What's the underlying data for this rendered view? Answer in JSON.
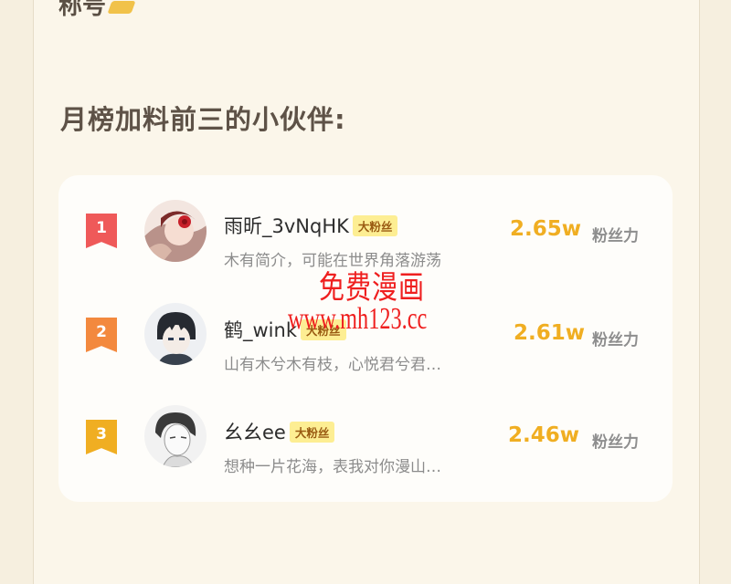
{
  "section": {
    "top_fragment": "称号",
    "heading": "月榜加料前三的小伙伴:"
  },
  "ranking": [
    {
      "rank": "1",
      "name": "雨昕_3vNqHK",
      "badge": "大粉丝",
      "bio": "木有简介，可能在世界角落游荡",
      "score": "2.65w",
      "unit": "粉丝力",
      "avatar_icon": "anime-girl-red-flower-avatar"
    },
    {
      "rank": "2",
      "name": "鹤_wink",
      "badge": "大粉丝",
      "bio": "山有木兮木有枝，心悦君兮君…",
      "score": "2.61w",
      "unit": "粉丝力",
      "avatar_icon": "anime-boy-dark-hair-avatar"
    },
    {
      "rank": "3",
      "name": "幺幺ee",
      "badge": "大粉丝",
      "bio": "想种一片花海，表我对你漫山…",
      "score": "2.46w",
      "unit": "粉丝力",
      "avatar_icon": "sketch-boy-avatar"
    }
  ],
  "watermark": {
    "line1": "免费漫画",
    "line2": "www.mh123.cc"
  },
  "colors": {
    "background": "#f6efdf",
    "card": "#fefdfa",
    "rank1": "#ef5959",
    "rank2": "#f3893e",
    "rank3": "#f0ae22",
    "score": "#f0ae22",
    "badge_bg": "#fdee93",
    "watermark": "#ef1f1f"
  }
}
